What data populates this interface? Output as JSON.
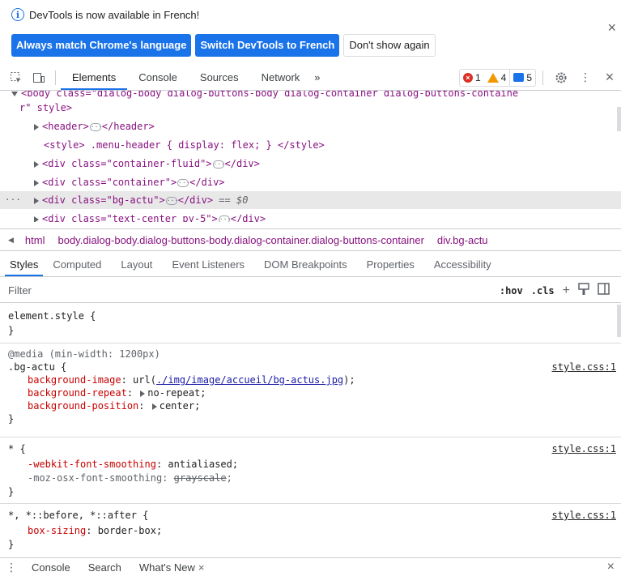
{
  "infobar": {
    "message": "DevTools is now available in French!",
    "buttons": {
      "match": "Always match Chrome's language",
      "switch": "Switch DevTools to French",
      "dismiss": "Don't show again"
    },
    "close": "×"
  },
  "toolbar": {
    "tabs": [
      "Elements",
      "Console",
      "Sources",
      "Network"
    ],
    "more": "»",
    "errors": "1",
    "warnings": "4",
    "messages": "5",
    "close": "×"
  },
  "dom": {
    "line0": {
      "prefix": "<body class=\"dialog-body dialog-buttons-body dialog-container dialog-buttons-containe",
      "wrap": "r\" style>"
    },
    "header": {
      "open": "<header>",
      "close": "</header>"
    },
    "style_line": "<style> .menu-header { display: flex; } </style>",
    "fluid": {
      "open": "<div class=\"container-fluid\">",
      "close": "</div>"
    },
    "container": {
      "open": "<div class=\"container\">",
      "close": "</div>"
    },
    "bgactu": {
      "open": "<div class=\"bg-actu\">",
      "close": "</div>",
      "suffix": " == $0"
    },
    "textcenter": {
      "open": "<div class=\"text-center py-5\">",
      "close": "</div>"
    }
  },
  "breadcrumb": {
    "items": [
      "html",
      "body.dialog-body.dialog-buttons-body.dialog-container.dialog-buttons-container",
      "div.bg-actu"
    ]
  },
  "styles_tabs": [
    "Styles",
    "Computed",
    "Layout",
    "Event Listeners",
    "DOM Breakpoints",
    "Properties",
    "Accessibility"
  ],
  "filter": {
    "placeholder": "Filter",
    "hov": ":hov",
    "cls": ".cls"
  },
  "rules": {
    "element_style": {
      "selector": "element.style {",
      "close": "}"
    },
    "bg_actu": {
      "media": "@media (min-width: 1200px)",
      "selector": ".bg-actu {",
      "source": "style.css:1",
      "decls": [
        {
          "prop": "background-image",
          "pre": "url(",
          "link": "./img/image/accueil/bg-actus.jpg",
          "post": ");"
        },
        {
          "prop": "background-repeat",
          "value": "no-repeat;"
        },
        {
          "prop": "background-position",
          "value": "center;"
        }
      ],
      "close": "}"
    },
    "universal": {
      "selector": "* {",
      "source": "style.css:1",
      "decl1": {
        "prop": "-webkit-font-smoothing",
        "value": "antialiased;"
      },
      "decl2": {
        "prop": "-moz-osx-font-smoothing",
        "value": "grayscale",
        "end": ";"
      },
      "close": "}"
    },
    "pseudo": {
      "selector": "*, *::before, *::after {",
      "source": "style.css:1",
      "decl": {
        "prop": "box-sizing",
        "value": "border-box;"
      },
      "close": "}"
    }
  },
  "drawer": {
    "tabs": [
      "Console",
      "Search",
      "What's New"
    ],
    "close_tab": "×",
    "close": "×"
  },
  "colors": {
    "accent": "#1a73e8",
    "error": "#d93025",
    "warning": "#f29900"
  }
}
